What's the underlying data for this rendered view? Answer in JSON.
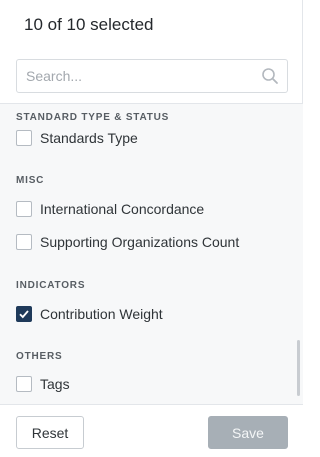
{
  "header": {
    "title": "10 of 10 selected"
  },
  "search": {
    "placeholder": "Search..."
  },
  "groups": [
    {
      "title": "STANDARD TYPE & STATUS",
      "items": [
        {
          "label": "Standards Type",
          "checked": false
        }
      ]
    },
    {
      "title": "MISC",
      "items": [
        {
          "label": "International Concordance",
          "checked": false
        },
        {
          "label": "Supporting Organizations Count",
          "checked": false
        }
      ]
    },
    {
      "title": "INDICATORS",
      "items": [
        {
          "label": "Contribution Weight",
          "checked": true
        }
      ]
    },
    {
      "title": "OTHERS",
      "items": [
        {
          "label": "Tags",
          "checked": false
        }
      ]
    }
  ],
  "footer": {
    "reset_label": "Reset",
    "save_label": "Save"
  },
  "colors": {
    "checked_fill": "#1f3a5a",
    "save_disabled": "#a7afb6"
  },
  "icons": {
    "search": "search-icon",
    "check": "check-icon"
  }
}
